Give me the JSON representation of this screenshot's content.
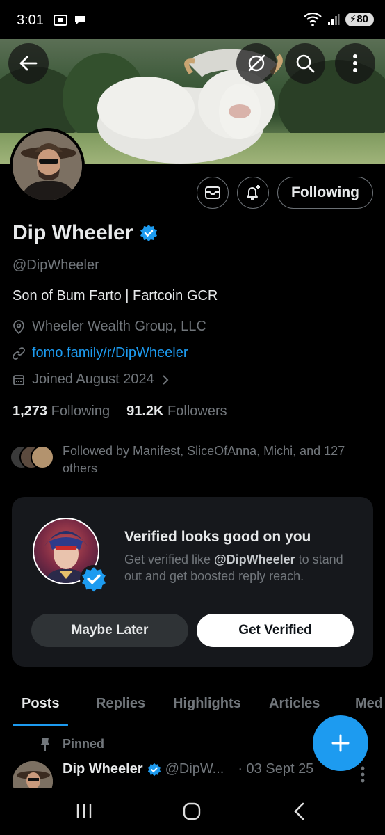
{
  "status_bar": {
    "time": "3:01",
    "battery": "80"
  },
  "profile": {
    "name": "Dip Wheeler",
    "handle": "@DipWheeler",
    "bio": "Son of Bum Farto | Fartcoin GCR",
    "location": "Wheeler Wealth Group, LLC",
    "link": "fomo.family/r/DipWheeler",
    "joined": "Joined August 2024",
    "following_count": "1,273",
    "following_label": "Following",
    "followers_count": "91.2K",
    "followers_label": "Followers",
    "followed_by": "Followed by Manifest, SliceOfAnna, Michi, and 127 others",
    "follow_button_label": "Following"
  },
  "verified_card": {
    "title": "Verified looks good on you",
    "text_before": "Get verified like ",
    "text_handle": "@DipWheeler",
    "text_after": " to stand out and get boosted reply reach.",
    "maybe_later_label": "Maybe Later",
    "get_verified_label": "Get Verified"
  },
  "tabs": [
    {
      "label": "Posts",
      "active": true
    },
    {
      "label": "Replies",
      "active": false
    },
    {
      "label": "Highlights",
      "active": false
    },
    {
      "label": "Articles",
      "active": false
    },
    {
      "label": "Med",
      "active": false
    }
  ],
  "pinned_tweet": {
    "pinned_label": "Pinned",
    "name": "Dip Wheeler",
    "handle": "@DipW...",
    "date": "· 03 Sept 25"
  },
  "colors": {
    "accent": "#1d9bf0",
    "background": "#000000",
    "muted": "#71767b"
  },
  "icons": [
    "back-arrow-icon",
    "grok-icon",
    "search-icon",
    "more-icon",
    "mail-icon",
    "bell-plus-icon",
    "verified-badge-icon",
    "location-icon",
    "link-icon",
    "calendar-icon",
    "chevron-right-icon",
    "pin-icon",
    "plus-icon",
    "nav-recents-icon",
    "nav-home-icon",
    "nav-back-icon"
  ]
}
